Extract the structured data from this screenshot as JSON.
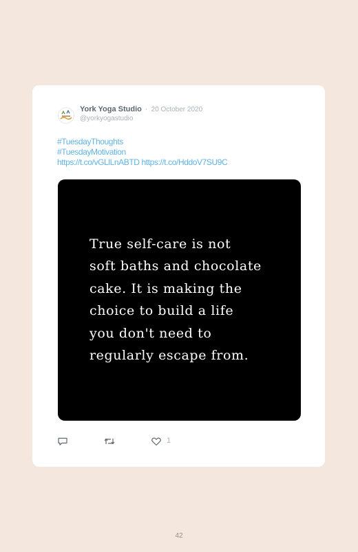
{
  "tweet": {
    "author_name": "York Yoga Studio",
    "separator": "·",
    "date": "20 October 2020",
    "handle": "@yorkyogastudio",
    "hashtags": [
      "#TuesdayThoughts",
      "#TuesdayMotivation"
    ],
    "links": [
      "https://t.co/vGLlLnABTD",
      "https://t.co/HddoV7SU9C"
    ],
    "image_quote_lines": [
      "True self-care is not",
      "soft baths and chocolate",
      "cake. It is making the",
      "choice to build a life",
      "you don't need to",
      "regularly escape from."
    ],
    "actions": {
      "reply_icon": "reply-icon",
      "retweet_icon": "retweet-icon",
      "like_icon": "heart-icon",
      "like_count": "1"
    }
  },
  "page_number": "42",
  "colors": {
    "page_background": "#f3e7de",
    "card_background": "#ffffff",
    "link": "#5fb2e4",
    "muted_text": "#a8b3ba",
    "author_text": "#5b6770",
    "media_background": "#000000"
  }
}
